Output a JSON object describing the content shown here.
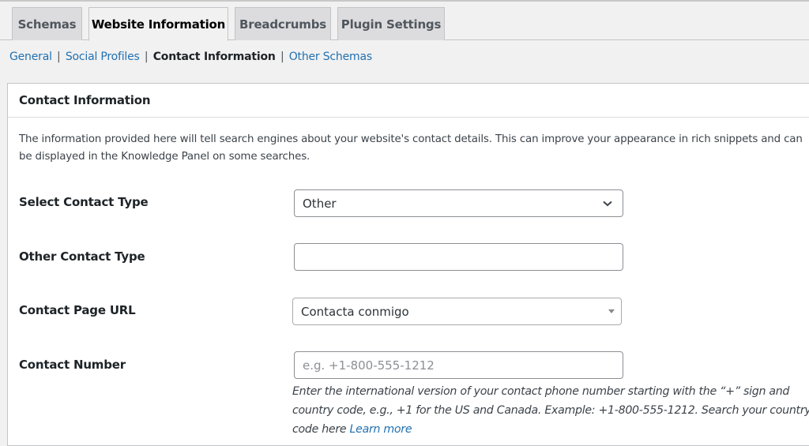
{
  "tabs": [
    {
      "label": "Schemas",
      "active": false
    },
    {
      "label": "Website Information",
      "active": true
    },
    {
      "label": "Breadcrumbs",
      "active": false
    },
    {
      "label": "Plugin Settings",
      "active": false
    }
  ],
  "subnav": {
    "items": [
      {
        "label": "General",
        "current": false
      },
      {
        "label": "Social Profiles",
        "current": false
      },
      {
        "label": "Contact Information",
        "current": true
      },
      {
        "label": "Other Schemas",
        "current": false
      }
    ],
    "separator": "|"
  },
  "panel": {
    "title": "Contact Information",
    "description": "The information provided here will tell search engines about your website's contact details. This can improve your appearance in rich snippets and can be displayed in the Knowledge Panel on some searches.",
    "fields": {
      "contact_type": {
        "label": "Select Contact Type",
        "value": "Other",
        "icon": "chevron-down-icon"
      },
      "other_contact_type": {
        "label": "Other Contact Type",
        "value": "",
        "placeholder": ""
      },
      "contact_page_url": {
        "label": "Contact Page URL",
        "value": "Contacta conmigo",
        "icon": "caret-down-icon"
      },
      "contact_number": {
        "label": "Contact Number",
        "value": "",
        "placeholder": "e.g. +1-800-555-1212",
        "help_text": "Enter the international version of your contact phone number starting with the “+” sign and country code, e.g., +1 for the US and Canada. Example: +1-800-555-1212. Search your country code here",
        "help_link": "Learn more"
      }
    }
  },
  "colors": {
    "link": "#2271b1",
    "background": "#f1f1f1",
    "panel": "#ffffff"
  }
}
